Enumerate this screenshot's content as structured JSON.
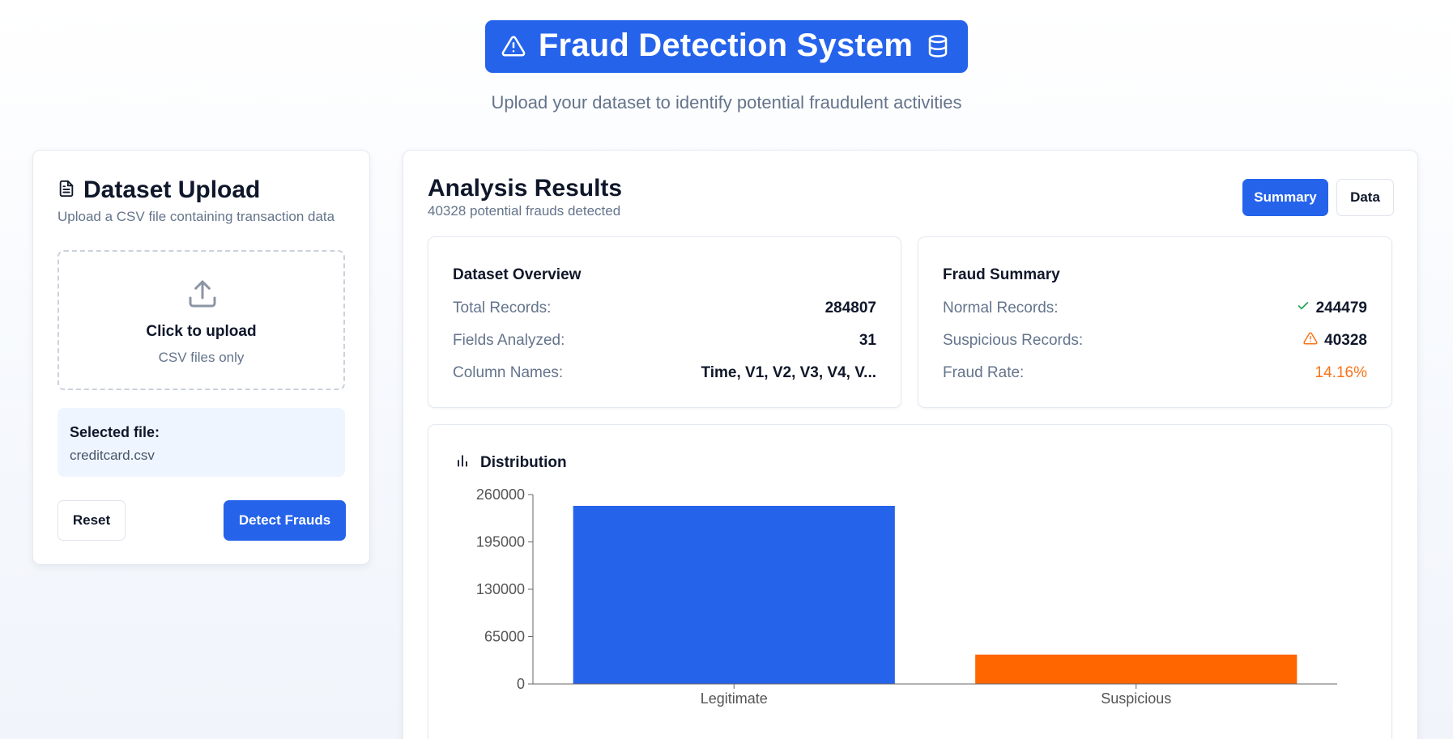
{
  "header": {
    "title": "Fraud Detection System",
    "subtitle": "Upload your dataset to identify potential fraudulent activities",
    "left_icon": "warning-triangle-icon",
    "right_icon": "database-icon"
  },
  "upload": {
    "title": "Dataset Upload",
    "description": "Upload a CSV file containing transaction data",
    "dropzone_title": "Click to upload",
    "dropzone_hint": "CSV files only",
    "selected_label": "Selected file:",
    "selected_file": "creditcard.csv",
    "reset_label": "Reset",
    "detect_label": "Detect Frauds"
  },
  "results": {
    "title": "Analysis Results",
    "subtitle": "40328 potential frauds detected",
    "tabs": {
      "summary": "Summary",
      "data": "Data"
    },
    "overview": {
      "title": "Dataset Overview",
      "rows": [
        {
          "label": "Total Records:",
          "value": "284807"
        },
        {
          "label": "Fields Analyzed:",
          "value": "31"
        },
        {
          "label": "Column Names:",
          "value": "Time, V1, V2, V3, V4, V..."
        }
      ]
    },
    "fraud_summary": {
      "title": "Fraud Summary",
      "rows": [
        {
          "label": "Normal Records:",
          "value": "244479"
        },
        {
          "label": "Suspicious Records:",
          "value": "40328"
        },
        {
          "label": "Fraud Rate:",
          "value": "14.16%"
        }
      ]
    },
    "distribution": {
      "title": "Distribution"
    }
  },
  "colors": {
    "primary": "#2563eb",
    "suspicious": "#f97316",
    "success": "#16a34a"
  },
  "chart_data": {
    "type": "bar",
    "categories": [
      "Legitimate",
      "Suspicious"
    ],
    "values": [
      244479,
      40328
    ],
    "colors": [
      "#2563eb",
      "#ff6600"
    ],
    "yticks": [
      0,
      65000,
      130000,
      195000,
      260000
    ],
    "ylim": [
      0,
      260000
    ],
    "title": "",
    "xlabel": "",
    "ylabel": ""
  }
}
